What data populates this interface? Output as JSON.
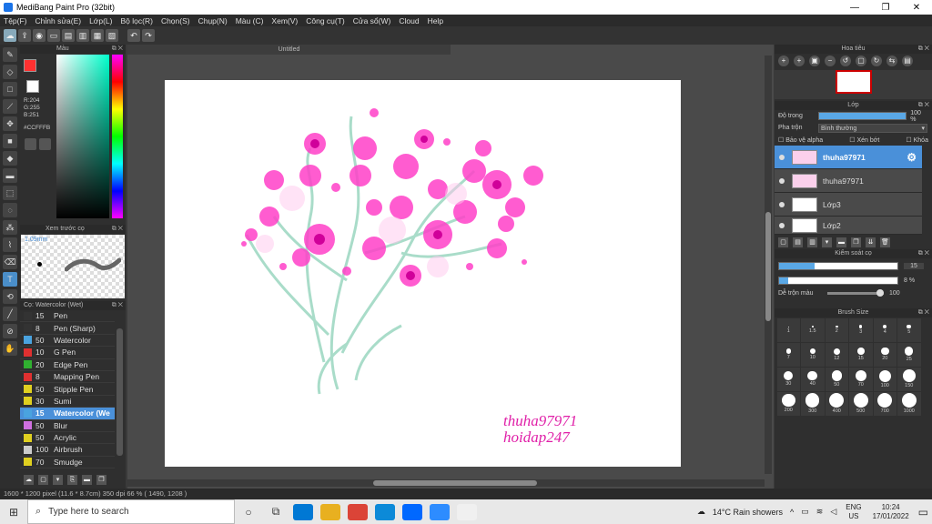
{
  "window": {
    "title": "MediBang Paint Pro (32bit)",
    "controls": [
      "—",
      "❐",
      "✕"
    ]
  },
  "menu": [
    "Tệp(F)",
    "Chỉnh sửa(E)",
    "Lớp(L)",
    "Bộ lọc(R)",
    "Chọn(S)",
    "Chụp(N)",
    "Màu (C)",
    "Xem(V)",
    "Công cụ(T)",
    "Cửa sổ(W)",
    "Cloud",
    "Help"
  ],
  "toolbar_icons": [
    "cloud-icon",
    "share-icon",
    "comment-icon",
    "chat-icon",
    "page-icon",
    "page2-icon",
    "grid-icon",
    "grid2-icon",
    "undo-icon",
    "redo-icon"
  ],
  "color_panel": {
    "title": "Màu",
    "rgb": {
      "r": "R:204",
      "g": "G:255",
      "b": "B:251"
    },
    "hex": "#CCFFFB",
    "fg_color": "#ff3030",
    "bg_color": "#ffffff"
  },
  "brush_preview": {
    "title": "Xem trước cọ",
    "size": "1.09mm"
  },
  "brush_panel": {
    "title": "Cọ: Watercolor (Wet)",
    "brushes": [
      {
        "size": "15",
        "name": "Pen",
        "color": "#333333"
      },
      {
        "size": "8",
        "name": "Pen (Sharp)",
        "color": "#333333"
      },
      {
        "size": "50",
        "name": "Watercolor",
        "color": "#4aa3df"
      },
      {
        "size": "10",
        "name": "G Pen",
        "color": "#e03030"
      },
      {
        "size": "20",
        "name": "Edge Pen",
        "color": "#30b030"
      },
      {
        "size": "8",
        "name": "Mapping Pen",
        "color": "#e03030"
      },
      {
        "size": "50",
        "name": "Stipple Pen",
        "color": "#e0d020"
      },
      {
        "size": "30",
        "name": "Sumi",
        "color": "#e0d020"
      },
      {
        "size": "15",
        "name": "Watercolor (We",
        "color": "#4aa3df"
      },
      {
        "size": "50",
        "name": "Blur",
        "color": "#d070e0"
      },
      {
        "size": "50",
        "name": "Acrylic",
        "color": "#e0d020"
      },
      {
        "size": "100",
        "name": "Airbrush",
        "color": "#cccccc"
      },
      {
        "size": "70",
        "name": "Smudge",
        "color": "#e0d020"
      }
    ],
    "active_index": 8
  },
  "canvas": {
    "tab": "Untitled",
    "signature_line1": "thuha97971",
    "signature_line2": "hoidap247"
  },
  "navigator": {
    "title": "Hoa tiêu"
  },
  "layer_panel": {
    "title": "Lớp",
    "opacity_label": "Độ trong",
    "opacity_value": "100 %",
    "opacity": 1.0,
    "blend_label": "Pha trộn",
    "blend_value": "Bình thường",
    "opt_alpha": "Bảo vệ alpha",
    "opt_clip": "Xén bớt",
    "opt_lock": "Khóa",
    "layers": [
      {
        "name": "thuha97971"
      },
      {
        "name": "thuha97971"
      },
      {
        "name": "Lớp3"
      },
      {
        "name": "Lớp2"
      }
    ]
  },
  "brush_control": {
    "title": "Kiểm soát cọ",
    "size_value": "15",
    "size_fill": 0.3,
    "opacity_value": "8 %",
    "opacity_fill": 0.08,
    "blend_label": "Dễ trộn màu",
    "blend_value": "100"
  },
  "brush_size": {
    "title": "Brush Size",
    "sizes": [
      "1",
      "1.5",
      "2",
      "3",
      "4",
      "5",
      "7",
      "10",
      "12",
      "15",
      "20",
      "25",
      "30",
      "40",
      "50",
      "70",
      "100",
      "150",
      "200",
      "300",
      "400",
      "500",
      "700",
      "1000"
    ]
  },
  "status": {
    "text": "1600 * 1200 pixel   (11.6 * 8.7cm)   350 dpi   66 %   ( 1490, 1208 )"
  },
  "taskbar": {
    "search_placeholder": "Type here to search",
    "weather": "14°C  Rain showers",
    "lang": "ENG",
    "region": "US",
    "time": "10:24",
    "date": "17/01/2022",
    "apps": [
      {
        "icon": "mail-icon",
        "color": "#0078d4"
      },
      {
        "icon": "folder-icon",
        "color": "#e8b020"
      },
      {
        "icon": "chrome-icon",
        "color": "#db4437"
      },
      {
        "icon": "edge-icon",
        "color": "#0c8ad8"
      },
      {
        "icon": "zalo-icon",
        "color": "#0068ff"
      },
      {
        "icon": "zoom-icon",
        "color": "#2d8cff"
      },
      {
        "icon": "medibang-icon",
        "color": "#f0f0f0"
      }
    ]
  }
}
